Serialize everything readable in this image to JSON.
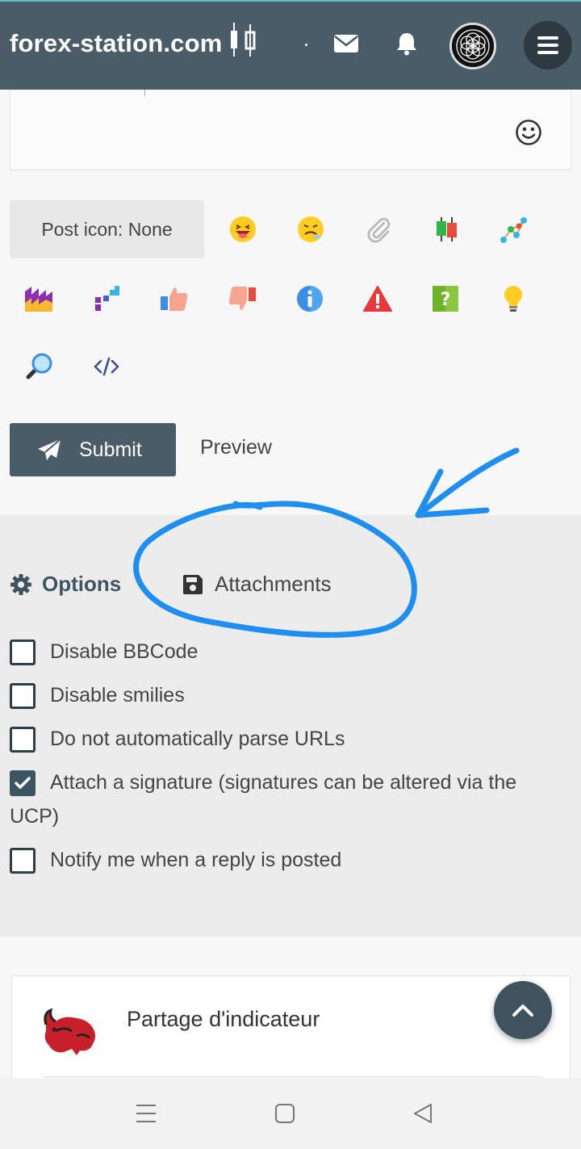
{
  "header": {
    "logo_text": "forex-station.com",
    "icons": [
      "envelope-icon",
      "bell-icon",
      "avatar",
      "hamburger-menu-icon"
    ],
    "bg_color": "#495c67"
  },
  "editor": {
    "smiley_icon": "smiley-icon"
  },
  "post_icon": {
    "label": "Post icon: None"
  },
  "post_icons": [
    "laughing-face-icon",
    "confounded-face-icon",
    "paperclip-icon",
    "candlestick-icon",
    "network-icon",
    "factory-icon",
    "bar-chart-icon",
    "thumbs-up-icon",
    "thumbs-down-icon",
    "info-icon",
    "warning-icon",
    "question-icon",
    "lightbulb-icon",
    "magnifier-icon",
    "code-icon"
  ],
  "actions": {
    "submit_label": "Submit",
    "preview_label": "Preview"
  },
  "tabs": {
    "options_label": "Options",
    "attachments_label": "Attachments"
  },
  "options": [
    {
      "label": "Disable BBCode",
      "checked": false
    },
    {
      "label": "Disable smilies",
      "checked": false
    },
    {
      "label": "Do not automatically parse URLs",
      "checked": false
    },
    {
      "label": "Attach a signature (signatures can be altered via the UCP)",
      "checked": true
    },
    {
      "label": "Notify me when a reply is posted",
      "checked": false
    }
  ],
  "card": {
    "title": "Partage d'indicateur"
  },
  "colors": {
    "accent": "#495c67",
    "annotation": "#1e90ff"
  }
}
